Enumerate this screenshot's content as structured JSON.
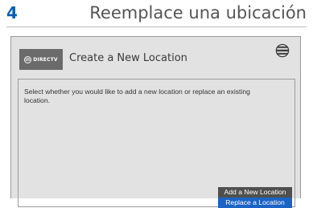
{
  "header": {
    "step_number": "4",
    "title": "Reemplace una ubicación"
  },
  "screen": {
    "brand_badge": "DIRECTV",
    "title": "Create a New Location",
    "instruction": "Select whether you would like to add a new location or replace an existing location.",
    "options": [
      {
        "label": "Add a New Location",
        "selected": false
      },
      {
        "label": "Replace a Location",
        "selected": true
      }
    ],
    "icons": [
      "directv-logo-icon",
      "att-globe-icon"
    ],
    "colors": {
      "step_number": "#0a5fb4",
      "screen_background": "#e2e2e2",
      "brand_badge": "#6b6b6b",
      "option_default": "#4f4f4f",
      "option_selected": "#1c63c6"
    }
  }
}
